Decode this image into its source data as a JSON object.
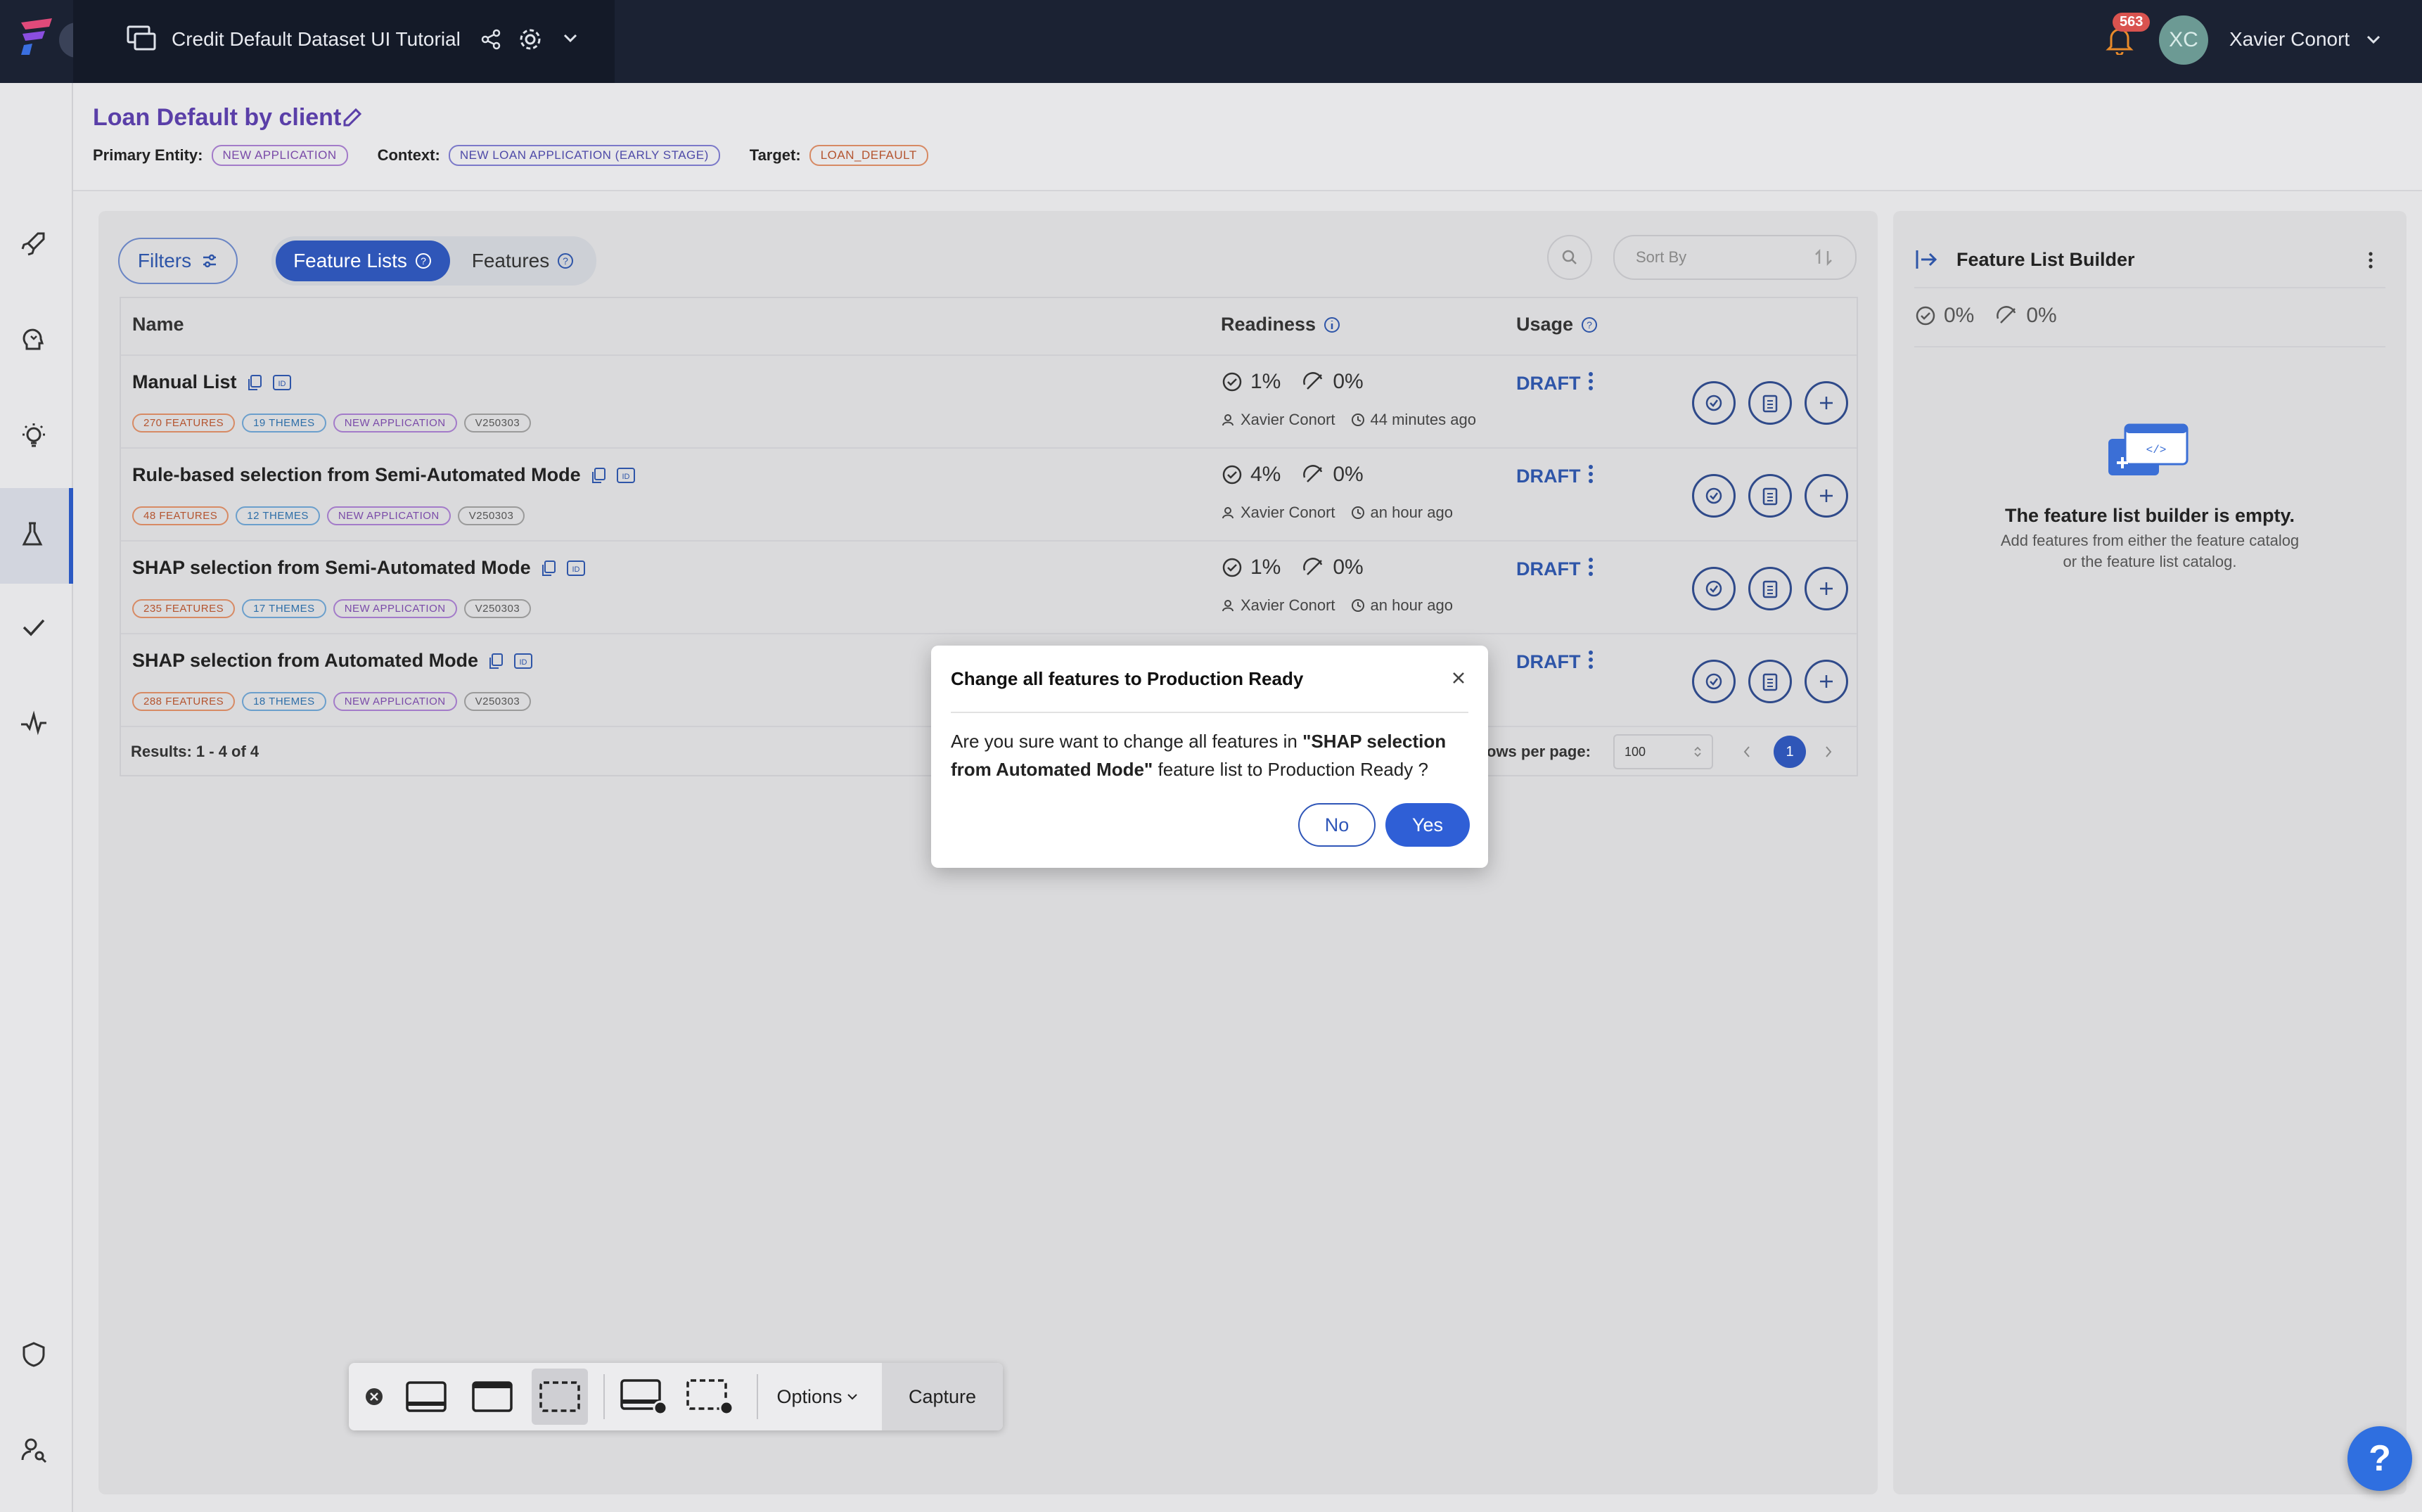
{
  "topbar": {
    "project_title": "Credit Default Dataset UI Tutorial",
    "notification_count": "563",
    "user_initials": "XC",
    "user_name": "Xavier Conort"
  },
  "header": {
    "title": "Loan Default by client",
    "primary_entity_label": "Primary Entity:",
    "primary_entity": "NEW APPLICATION",
    "context_label": "Context:",
    "context": "NEW LOAN APPLICATION (EARLY STAGE)",
    "target_label": "Target:",
    "target": "LOAN_DEFAULT"
  },
  "controls": {
    "filters_label": "Filters",
    "tab_feature_lists": "Feature Lists",
    "tab_features": "Features",
    "sort_placeholder": "Sort By"
  },
  "table": {
    "columns": [
      "Name",
      "Readiness",
      "Usage"
    ],
    "rows": [
      {
        "name": "Manual List",
        "tags": [
          "270 FEATURES",
          "19 THEMES",
          "NEW APPLICATION",
          "V250303"
        ],
        "ready": "1%",
        "online": "0%",
        "author": "Xavier Conort",
        "time": "44 minutes ago",
        "status": "DRAFT"
      },
      {
        "name": "Rule-based selection from Semi-Automated Mode",
        "tags": [
          "48 FEATURES",
          "12 THEMES",
          "NEW APPLICATION",
          "V250303"
        ],
        "ready": "4%",
        "online": "0%",
        "author": "Xavier Conort",
        "time": "an hour ago",
        "status": "DRAFT"
      },
      {
        "name": "SHAP selection from Semi-Automated Mode",
        "tags": [
          "235 FEATURES",
          "17 THEMES",
          "NEW APPLICATION",
          "V250303"
        ],
        "ready": "1%",
        "online": "0%",
        "author": "Xavier Conort",
        "time": "an hour ago",
        "status": "DRAFT"
      },
      {
        "name": "SHAP selection from Automated Mode",
        "tags": [
          "288 FEATURES",
          "18 THEMES",
          "NEW APPLICATION",
          "V250303"
        ],
        "status": "DRAFT"
      }
    ],
    "results": "Results: 1 - 4 of 4",
    "rows_per_page_label": "ows per page:",
    "rows_per_page": "100",
    "current_page": "1"
  },
  "builder": {
    "title": "Feature List Builder",
    "ready": "0%",
    "online": "0%",
    "empty_title": "The feature list builder is empty.",
    "empty_line1": "Add features from either the feature catalog",
    "empty_line2": "or the feature list catalog."
  },
  "modal": {
    "title": "Change all features to Production Ready",
    "body_prefix": "Are you sure want to change all features in ",
    "body_bold": "\"SHAP selection from Automated Mode\"",
    "body_suffix": " feature list to Production Ready ?",
    "no_label": "No",
    "yes_label": "Yes"
  },
  "capture_toolbar": {
    "options_label": "Options",
    "capture_label": "Capture"
  },
  "help_label": "?",
  "colors": {
    "accent": "#2f56b8",
    "topbar": "#1b2233",
    "title": "#5a3fa8",
    "badge": "#d9534f"
  }
}
